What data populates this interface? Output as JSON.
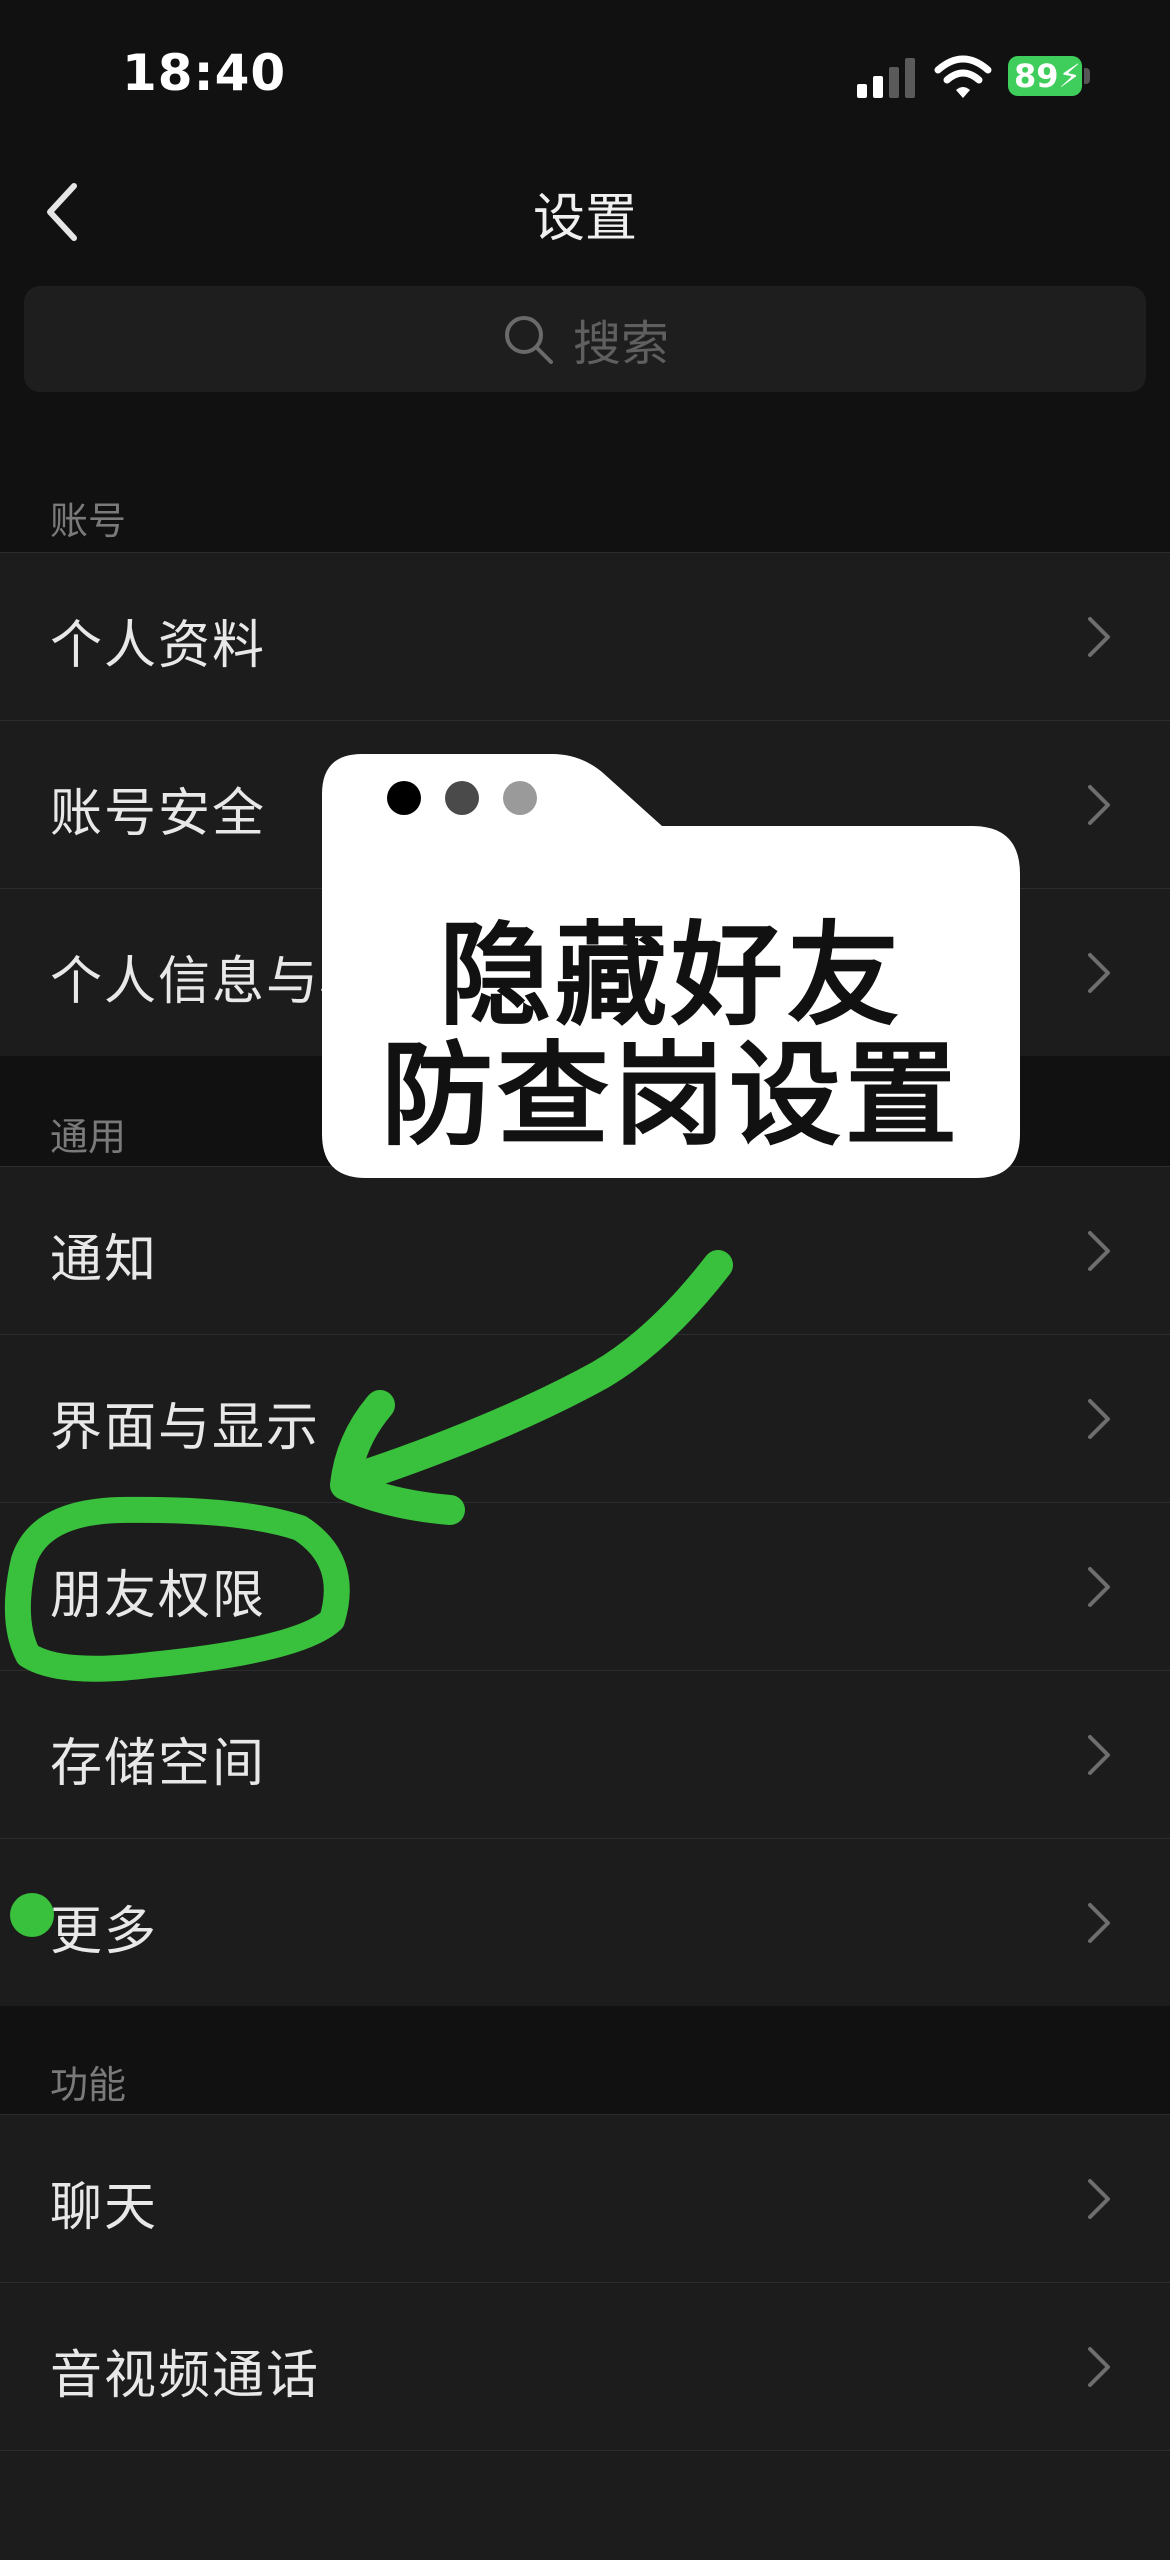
{
  "status_bar": {
    "time": "18:40",
    "battery": "89"
  },
  "nav": {
    "title": "设置"
  },
  "search": {
    "placeholder": "搜索"
  },
  "sections": {
    "account": {
      "label": "账号",
      "items": [
        "个人资料",
        "账号安全",
        "个人信息与权限"
      ]
    },
    "general": {
      "label": "通用",
      "items": [
        "通知",
        "界面与显示",
        "朋友权限",
        "存储空间",
        "更多"
      ]
    },
    "features": {
      "label": "功能",
      "items": [
        "聊天",
        "音视频通话"
      ]
    }
  },
  "overlay": {
    "line1": "隐藏好友",
    "line2": "防查岗设置"
  },
  "colors": {
    "background": "#111111",
    "row_background": "#1c1c1c",
    "annotation_green": "#39c03c",
    "battery_green": "#3fce5b"
  }
}
